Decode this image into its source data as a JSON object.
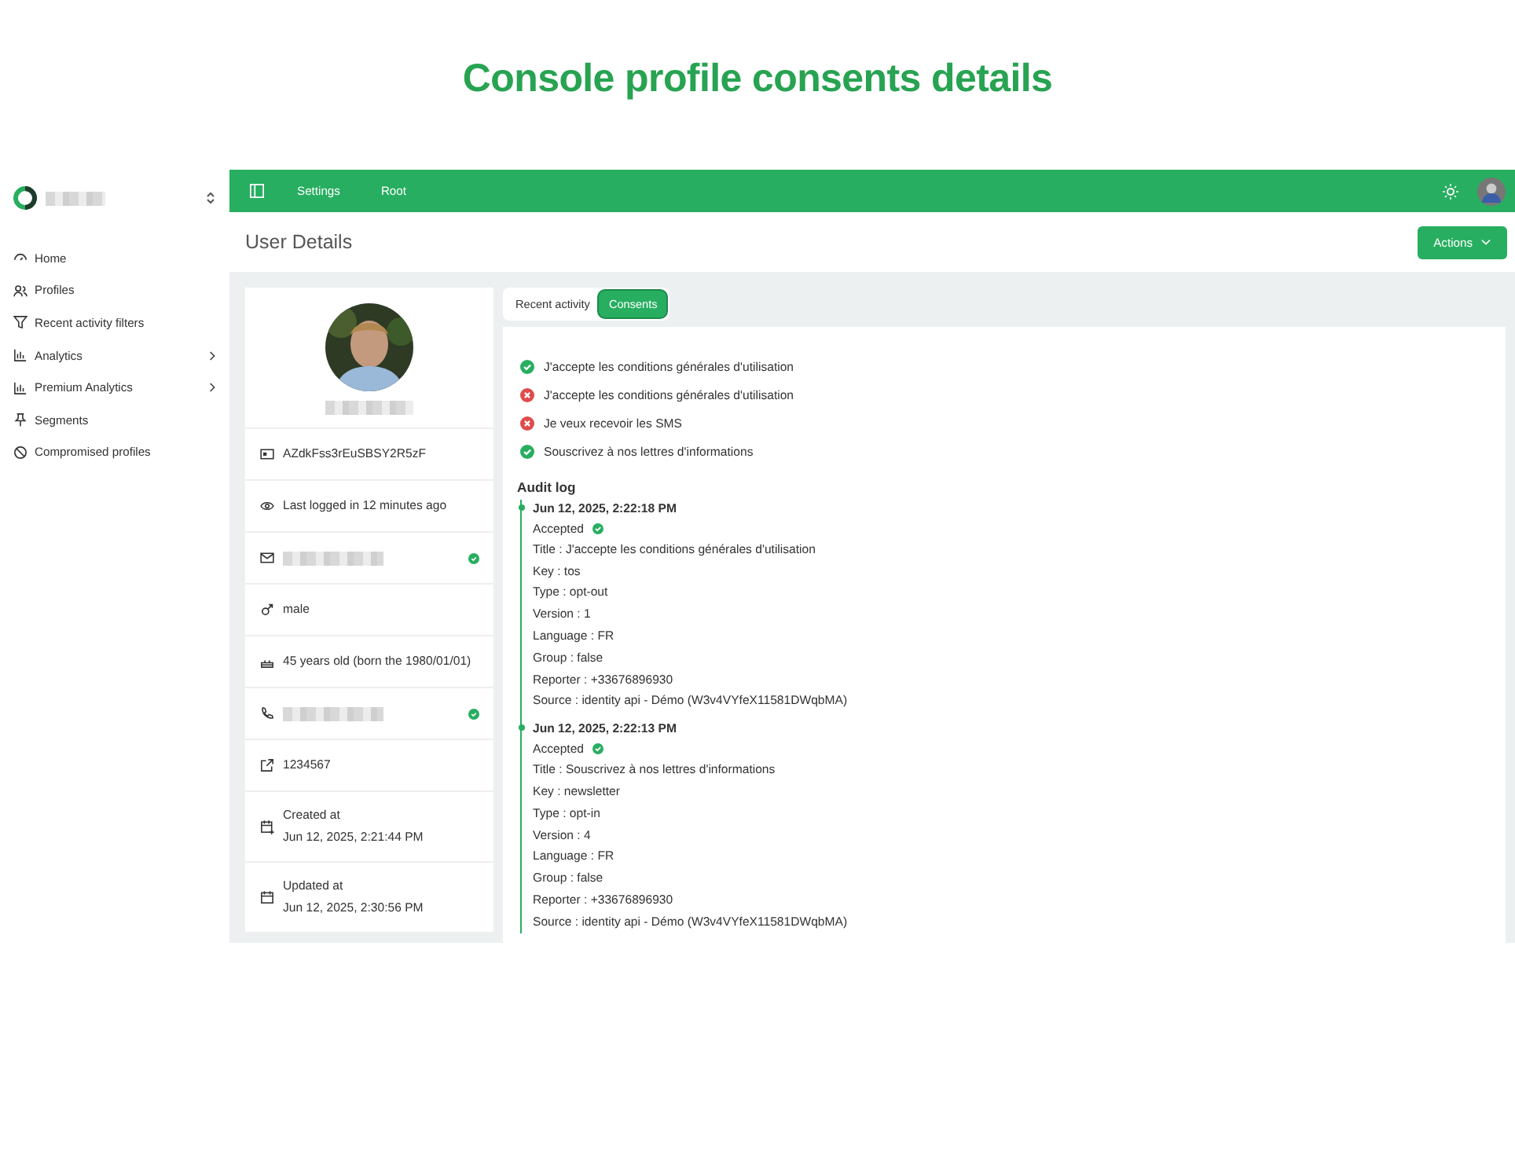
{
  "page_title": "Console profile consents details",
  "sidebar": {
    "items": [
      {
        "label": "Home",
        "expandable": false
      },
      {
        "label": "Profiles",
        "expandable": false
      },
      {
        "label": "Recent activity filters",
        "expandable": false
      },
      {
        "label": "Analytics",
        "expandable": true
      },
      {
        "label": "Premium Analytics",
        "expandable": true
      },
      {
        "label": "Segments",
        "expandable": false
      },
      {
        "label": "Compromised profiles",
        "expandable": false
      }
    ]
  },
  "topbar": {
    "links": [
      "Settings",
      "Root"
    ]
  },
  "header": {
    "title": "User Details",
    "actions_button": "Actions"
  },
  "profile": {
    "rows": [
      {
        "text": "AZdkFss3rEuSBSY2R5zF"
      },
      {
        "text": "Last logged in 12 minutes ago"
      },
      {
        "verified": true
      },
      {
        "text": "male"
      },
      {
        "text": "45 years old (born the 1980/01/01)"
      },
      {
        "verified": true
      },
      {
        "text": "1234567"
      },
      {
        "label": "Created at",
        "text": "Jun 12, 2025, 2:21:44 PM"
      },
      {
        "label": "Updated at",
        "text": "Jun 12, 2025, 2:30:56 PM"
      }
    ]
  },
  "tabs": [
    {
      "label": "Recent activity",
      "selected": false
    },
    {
      "label": "Consents",
      "selected": true
    }
  ],
  "consents": [
    {
      "label": "J'accepte les conditions générales d'utilisation",
      "accepted": true
    },
    {
      "label": "J'accepte les conditions générales d'utilisation",
      "accepted": false
    },
    {
      "label": "Je veux recevoir les SMS",
      "accepted": false
    },
    {
      "label": "Souscrivez à nos lettres d'informations",
      "accepted": true
    }
  ],
  "audit_log": {
    "title": "Audit log",
    "entries": [
      {
        "date": "Jun 12, 2025, 2:22:18 PM",
        "status": "Accepted",
        "accepted": true,
        "fields": [
          "Title : J'accepte les conditions générales d'utilisation",
          "Key : tos",
          "Type : opt-out",
          "Version : 1",
          "Language : FR",
          "Group : false",
          "Reporter : +33676896930",
          "Source : identity api - Démo (W3v4VYfeX11581DWqbMA)"
        ]
      },
      {
        "date": "Jun 12, 2025, 2:22:13 PM",
        "status": "Accepted",
        "accepted": true,
        "fields": [
          "Title : Souscrivez à nos lettres d'informations",
          "Key : newsletter",
          "Type : opt-in",
          "Version : 4",
          "Language : FR",
          "Group : false",
          "Reporter : +33676896930",
          "Source : identity api - Démo (W3v4VYfeX11581DWqbMA)"
        ]
      }
    ]
  }
}
